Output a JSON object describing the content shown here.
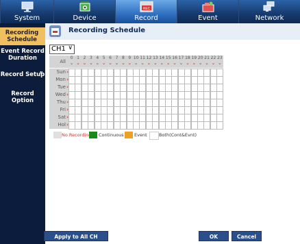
{
  "topnav": {
    "tabs": [
      {
        "label": "System",
        "icon": "monitor-icon",
        "active": false
      },
      {
        "label": "Device",
        "icon": "camera-icon",
        "active": false
      },
      {
        "label": "Record",
        "icon": "record-rec-icon",
        "active": true
      },
      {
        "label": "Event",
        "icon": "alarm-icon",
        "active": false
      },
      {
        "label": "Network",
        "icon": "network-icon",
        "active": false
      }
    ]
  },
  "sidebar": {
    "items": [
      {
        "label": "Recording Schedule",
        "active": true
      },
      {
        "label": "Event Record Duration",
        "active": false
      },
      {
        "label": "Record Setup",
        "active": false
      },
      {
        "label": "Record Option",
        "active": false
      }
    ]
  },
  "header": {
    "title": "Recording Schedule"
  },
  "channel_select": {
    "value": "CH1"
  },
  "schedule": {
    "all_label": "All",
    "hours": [
      "0",
      "1",
      "2",
      "3",
      "4",
      "5",
      "6",
      "7",
      "8",
      "9",
      "10",
      "11",
      "12",
      "13",
      "14",
      "15",
      "16",
      "17",
      "18",
      "19",
      "20",
      "21",
      "22",
      "23"
    ],
    "days": [
      "Sun",
      "Mon",
      "Tue",
      "Wed",
      "Thu",
      "Fri",
      "Sat",
      "Hol"
    ]
  },
  "legend": {
    "items": [
      {
        "label": "No Recording",
        "color": "#e0e0e0"
      },
      {
        "label": "Continuous",
        "color": "#1a8a1a"
      },
      {
        "label": "Event",
        "color": "#f0a020"
      },
      {
        "label": "Both(Cont&Evnt)",
        "color": "#ffffff"
      }
    ]
  },
  "buttons": {
    "apply_all": "Apply to All CH",
    "ok": "OK",
    "cancel": "Cancel"
  },
  "colors": {
    "nav_bg": "#0d1e3e",
    "accent_active": "#f0c060",
    "grid_marker": "#c0392b",
    "no_recording_text": "#d03030"
  }
}
